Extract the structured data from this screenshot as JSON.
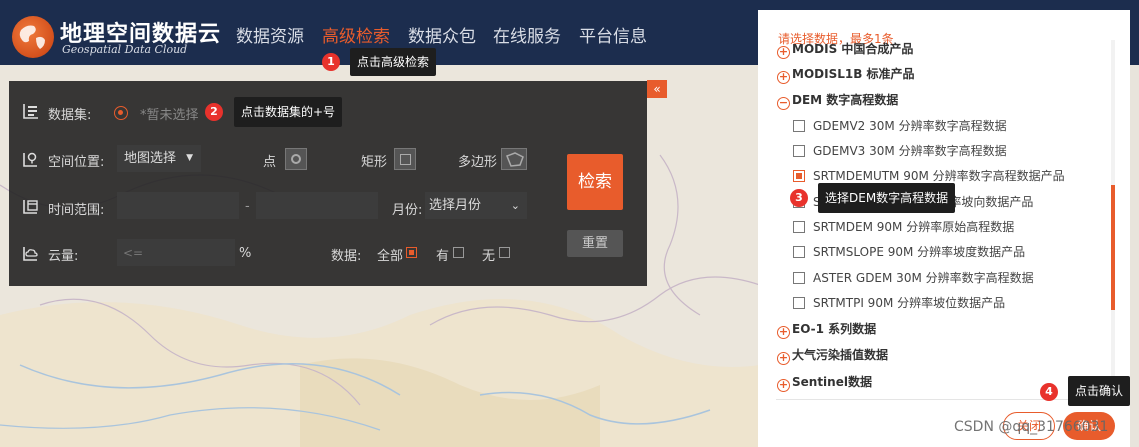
{
  "header": {
    "logo_cn": "地理空间数据云",
    "logo_en": "Geospatial Data Cloud",
    "nav": [
      "数据资源",
      "高级检索",
      "数据众包",
      "在线服务",
      "平台信息"
    ],
    "active_nav": "高级检索"
  },
  "search_panel": {
    "collapse_icon": "«",
    "dataset_label": "数据集:",
    "dataset_placeholder": "*暂未选择",
    "location_label": "空间位置:",
    "location_select": "地图选择",
    "point_label": "点",
    "rect_label": "矩形",
    "polygon_label": "多边形",
    "time_label": "时间范围:",
    "time_separator": "-",
    "month_label": "月份:",
    "month_select": "选择月份",
    "cloud_label": "云量:",
    "cloud_placeholder": "<=",
    "cloud_unit": "%",
    "data_label": "数据:",
    "opt_all": "全部",
    "opt_yes": "有",
    "opt_no": "无",
    "search_button": "检索",
    "reset_button": "重置"
  },
  "tooltips": [
    {
      "num": "1",
      "text": "点击高级检索"
    },
    {
      "num": "2",
      "text": "点击数据集的+号"
    },
    {
      "num": "3",
      "text": "选择DEM数字高程数据"
    },
    {
      "num": "4",
      "text": "点击确认"
    }
  ],
  "dataset_panel": {
    "hint": "请选择数据，最多1条",
    "categories_top": [
      {
        "mark": "+",
        "label": "MODIS 中国合成产品"
      },
      {
        "mark": "+",
        "label": "MODISL1B 标准产品"
      },
      {
        "mark": "−",
        "label": "DEM 数字高程数据"
      }
    ],
    "items": [
      {
        "label": "GDEMV2 30M 分辨率数字高程数据",
        "checked": false
      },
      {
        "label": "GDEMV3 30M 分辨率数字高程数据",
        "checked": false
      },
      {
        "label": "SRTMDEMUTM 90M 分辨率数字高程数据产品",
        "checked": true
      },
      {
        "label": "SRTMASPECT 90M 分辨率坡向数据产品",
        "checked": false
      },
      {
        "label": "SRTMDEM 90M 分辨率原始高程数据",
        "checked": false
      },
      {
        "label": "SRTMSLOPE 90M 分辨率坡度数据产品",
        "checked": false
      },
      {
        "label": "ASTER GDEM 30M 分辨率数字高程数据",
        "checked": false
      },
      {
        "label": "SRTMTPI 90M 分辨率坡位数据产品",
        "checked": false
      }
    ],
    "categories_bottom": [
      {
        "mark": "+",
        "label": "EO-1 系列数据"
      },
      {
        "mark": "+",
        "label": "大气污染插值数据"
      },
      {
        "mark": "+",
        "label": "Sentinel数据"
      }
    ],
    "close_button": "关闭",
    "confirm_button": "确认"
  },
  "watermark": "CSDN @qq_31766031",
  "colors": {
    "accent": "#e85c2c",
    "header_bg": "#1c2d4e",
    "panel_bg": "#1e1e1e",
    "badge": "#e8322c"
  }
}
